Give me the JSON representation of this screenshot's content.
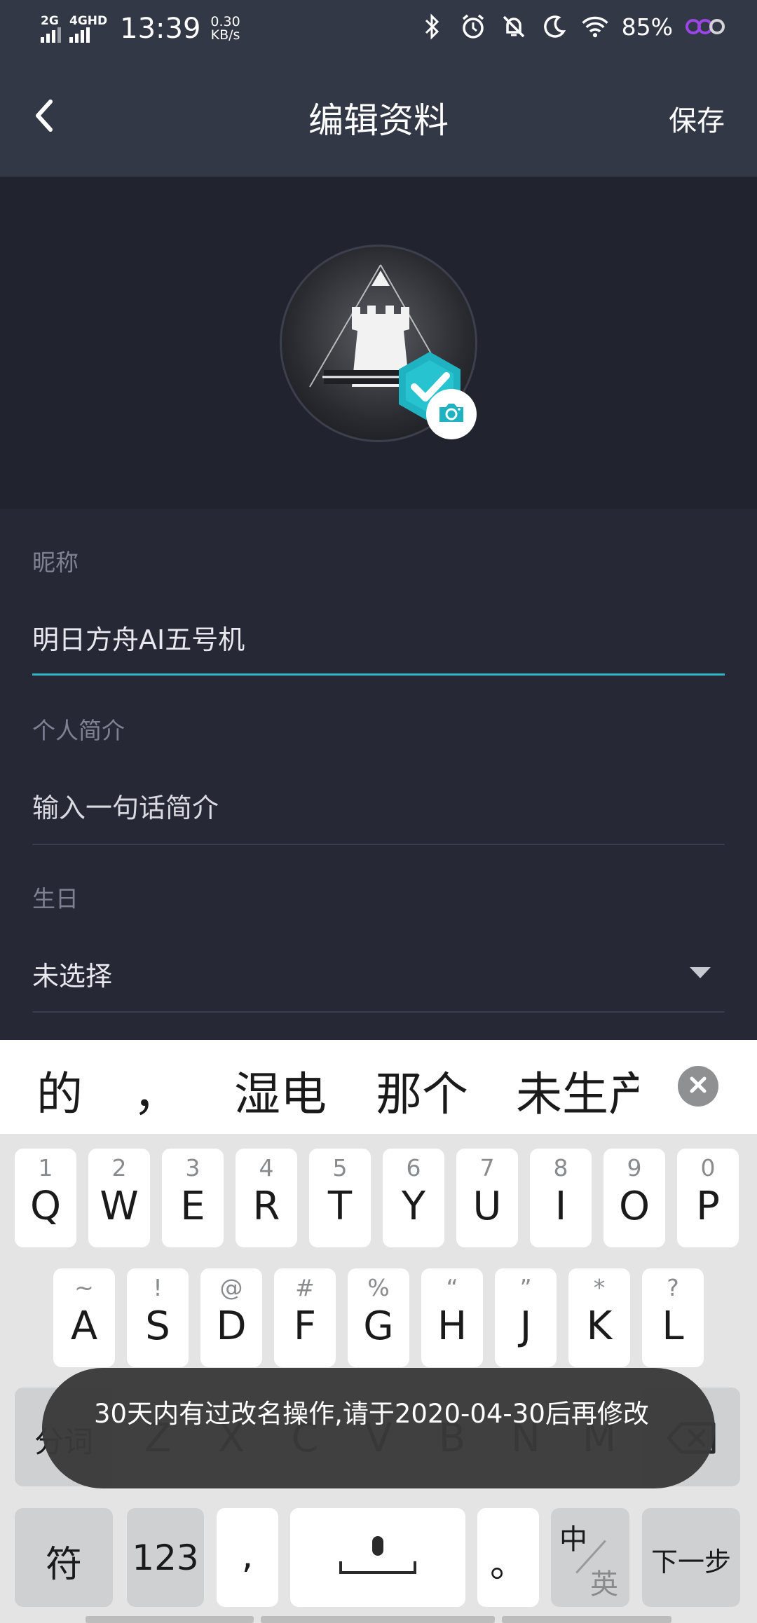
{
  "status_bar": {
    "sim1": "2G",
    "sim2": "4GHD",
    "time": "13:39",
    "speed_value": "0.30",
    "speed_unit": "KB/s",
    "battery": "85%"
  },
  "header": {
    "title": "编辑资料",
    "save_label": "保存"
  },
  "form": {
    "nickname_label": "昵称",
    "nickname_value": "明日方舟AI五号机",
    "bio_label": "个人简介",
    "bio_placeholder": "输入一句话简介",
    "birthday_label": "生日",
    "birthday_value": "未选择"
  },
  "keyboard": {
    "candidates": [
      "的",
      "，",
      "湿电",
      "那个",
      "未生产"
    ],
    "row1": [
      {
        "hint": "1",
        "key": "Q"
      },
      {
        "hint": "2",
        "key": "W"
      },
      {
        "hint": "3",
        "key": "E"
      },
      {
        "hint": "4",
        "key": "R"
      },
      {
        "hint": "5",
        "key": "T"
      },
      {
        "hint": "6",
        "key": "Y"
      },
      {
        "hint": "7",
        "key": "U"
      },
      {
        "hint": "8",
        "key": "I"
      },
      {
        "hint": "9",
        "key": "O"
      },
      {
        "hint": "0",
        "key": "P"
      }
    ],
    "row2": [
      {
        "hint": "~",
        "key": "A"
      },
      {
        "hint": "!",
        "key": "S"
      },
      {
        "hint": "@",
        "key": "D"
      },
      {
        "hint": "#",
        "key": "F"
      },
      {
        "hint": "%",
        "key": "G"
      },
      {
        "hint": "“",
        "key": "H"
      },
      {
        "hint": "”",
        "key": "J"
      },
      {
        "hint": "*",
        "key": "K"
      },
      {
        "hint": "?",
        "key": "L"
      }
    ],
    "row3": {
      "seg_label": "分词",
      "letters": [
        "Z",
        "X",
        "C",
        "V",
        "B",
        "N",
        "M"
      ]
    },
    "row4": {
      "symbols_label": "符",
      "numbers_label": "123",
      "comma_label": ",",
      "period_label": "。",
      "lang_top": "中",
      "lang_bottom": "英",
      "next_label": "下一步"
    }
  },
  "toast": {
    "message": "30天内有过改名操作,请于2020-04-30后再修改"
  }
}
